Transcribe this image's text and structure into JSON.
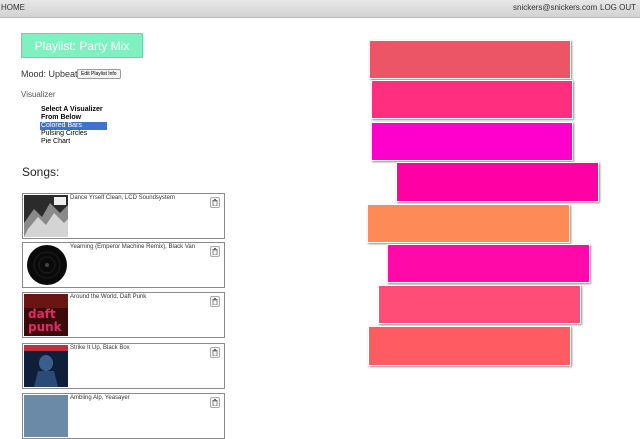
{
  "nav": {
    "home": "HOME",
    "email": "snickers@snickers.com",
    "logout": "LOG OUT"
  },
  "playlist": {
    "title": "Playlist: Party Mix",
    "mood": "Mood: Upbeat",
    "edit_label": "Edit Playlist Info",
    "title_color": "#7ff0c0"
  },
  "visualizer": {
    "heading": "Visualizer",
    "items": [
      {
        "label": "Select A Visualizer",
        "kind": "header"
      },
      {
        "label": "From Below",
        "kind": "header"
      },
      {
        "label": "Colored Bars",
        "kind": "selected"
      },
      {
        "label": "Pulsing Circles",
        "kind": "option"
      },
      {
        "label": "Pie Chart",
        "kind": "option"
      }
    ],
    "bar_colors": [
      "#ec5566",
      "#ff2e7e",
      "#ff00cc",
      "#ff00a4",
      "#fe8a58",
      "#ff0aa8",
      "#ff4d77",
      "#ff5b63"
    ]
  },
  "songs": {
    "heading": "Songs:",
    "items": [
      {
        "title": "Dance Yrself Clean, LCD Soundsystem",
        "art": "art-lcd",
        "icon": "trash-icon"
      },
      {
        "title": "Yearning (Emperor Machine Remix), Black Van",
        "art": "art-black-van",
        "icon": "trash-icon"
      },
      {
        "title": "Around the World, Daft Punk",
        "art": "art-daft-punk",
        "icon": "trash-icon"
      },
      {
        "title": "Strike It Up, Black Box",
        "art": "art-black-box",
        "icon": "trash-icon"
      },
      {
        "title": "Ambling Alp, Yeasayer",
        "art": "art-yeasayer",
        "icon": "trash-icon"
      }
    ]
  }
}
